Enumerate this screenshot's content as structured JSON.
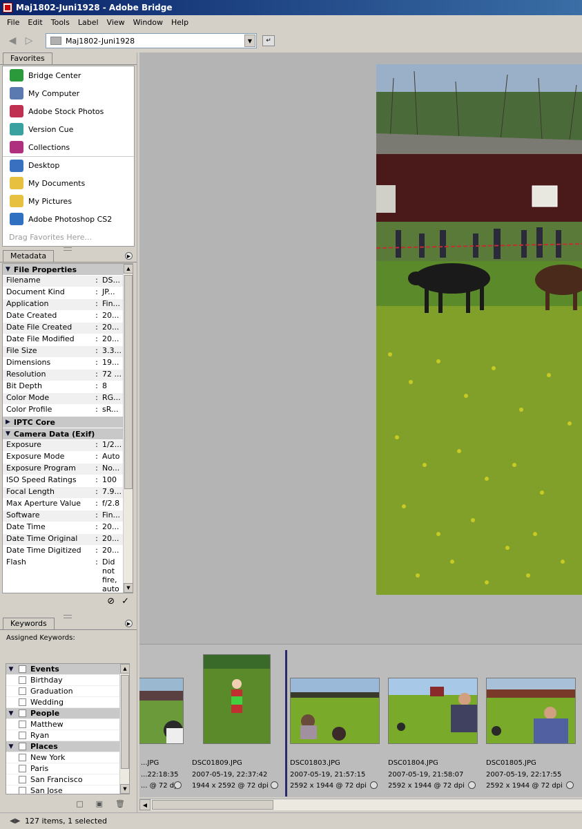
{
  "window": {
    "title": "Maj1802-Juni1928 - Adobe Bridge"
  },
  "menu": [
    "File",
    "Edit",
    "Tools",
    "Label",
    "View",
    "Window",
    "Help"
  ],
  "nav": {
    "path": "Maj1802-Juni1928"
  },
  "favorites": {
    "tab": "Favorites",
    "items": [
      {
        "label": "Bridge Center",
        "icon": "bridge-center-icon",
        "color": "#2a9a3a"
      },
      {
        "label": "My Computer",
        "icon": "computer-icon",
        "color": "#5a7ab0"
      },
      {
        "label": "Adobe Stock Photos",
        "icon": "stock-photos-icon",
        "color": "#c03050"
      },
      {
        "label": "Version Cue",
        "icon": "version-cue-icon",
        "color": "#3aa0a0"
      },
      {
        "label": "Collections",
        "icon": "collections-icon",
        "color": "#b03080"
      }
    ],
    "places": [
      {
        "label": "Desktop",
        "icon": "desktop-icon",
        "color": "#3a70c0"
      },
      {
        "label": "My Documents",
        "icon": "documents-folder-icon",
        "color": "#e8c040"
      },
      {
        "label": "My Pictures",
        "icon": "pictures-folder-icon",
        "color": "#e8c040"
      },
      {
        "label": "Adobe Photoshop CS2",
        "icon": "photoshop-icon",
        "color": "#3070c0"
      }
    ],
    "drag_hint": "Drag Favorites Here..."
  },
  "metadata": {
    "tab": "Metadata",
    "file_properties": {
      "title": "File Properties",
      "rows": [
        {
          "k": "Filename",
          "v": "DS..."
        },
        {
          "k": "Document Kind",
          "v": "JP..."
        },
        {
          "k": "Application",
          "v": "Fin..."
        },
        {
          "k": "Date Created",
          "v": "20..."
        },
        {
          "k": "Date File Created",
          "v": "20..."
        },
        {
          "k": "Date File Modified",
          "v": "20..."
        },
        {
          "k": "File Size",
          "v": "3.3..."
        },
        {
          "k": "Dimensions",
          "v": "19..."
        },
        {
          "k": "Resolution",
          "v": "72 ..."
        },
        {
          "k": "Bit Depth",
          "v": "8"
        },
        {
          "k": "Color Mode",
          "v": "RG..."
        },
        {
          "k": "Color Profile",
          "v": "sR..."
        }
      ]
    },
    "iptc": {
      "title": "IPTC Core"
    },
    "camera": {
      "title": "Camera Data (Exif)",
      "rows": [
        {
          "k": "Exposure",
          "v": "1/2..."
        },
        {
          "k": "Exposure Mode",
          "v": "Auto"
        },
        {
          "k": "Exposure Program",
          "v": "No..."
        },
        {
          "k": "ISO Speed Ratings",
          "v": "100"
        },
        {
          "k": "Focal Length",
          "v": "7.9..."
        },
        {
          "k": "Max Aperture Value",
          "v": "f/2.8"
        },
        {
          "k": "Software",
          "v": "Fin..."
        },
        {
          "k": "Date Time",
          "v": "20..."
        },
        {
          "k": "Date Time Original",
          "v": "20..."
        },
        {
          "k": "Date Time Digitized",
          "v": "20..."
        }
      ],
      "flash": {
        "k": "Flash",
        "v": "Did not fire, auto"
      }
    }
  },
  "keywords": {
    "tab": "Keywords",
    "assigned_label": "Assigned Keywords:",
    "groups": [
      {
        "name": "Events",
        "items": [
          "Birthday",
          "Graduation",
          "Wedding"
        ]
      },
      {
        "name": "People",
        "items": [
          "Matthew",
          "Ryan"
        ]
      },
      {
        "name": "Places",
        "items": [
          "New York",
          "Paris",
          "San Francisco",
          "San Jose"
        ]
      }
    ]
  },
  "filmstrip": [
    {
      "name": "...JPG",
      "date": "...22:18:35",
      "dims": "... @ 72 dpi"
    },
    {
      "name": "DSC01809.JPG",
      "date": "2007-05-19, 22:37:42",
      "dims": "1944 x 2592 @ 72 dpi"
    },
    {
      "name": "DSC01803.JPG",
      "date": "2007-05-19, 21:57:15",
      "dims": "2592 x 1944 @ 72 dpi"
    },
    {
      "name": "DSC01804.JPG",
      "date": "2007-05-19, 21:58:07",
      "dims": "2592 x 1944 @ 72 dpi"
    },
    {
      "name": "DSC01805.JPG",
      "date": "2007-05-19, 22:17:55",
      "dims": "2592 x 1944 @ 72 dpi"
    }
  ],
  "status": {
    "text": "127 items, 1 selected"
  }
}
